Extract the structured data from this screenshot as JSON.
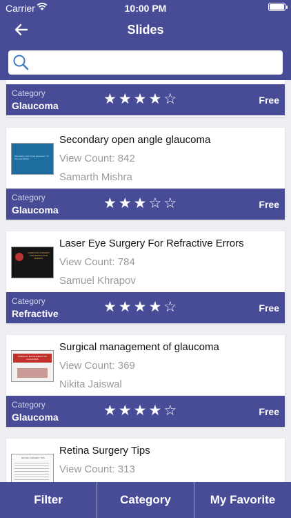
{
  "status": {
    "carrier": "Carrier",
    "time": "10:00 PM"
  },
  "header": {
    "title": "Slides"
  },
  "search": {
    "placeholder": "",
    "value": ""
  },
  "category_label": "Category",
  "top_card": {
    "category": "Glaucoma",
    "rating": 4,
    "price": "Free"
  },
  "slides": [
    {
      "title": "Secondary open angle glaucoma",
      "view_count": "View Count: 842",
      "author": "Samarth Mishra",
      "category": "Glaucoma",
      "rating": 3,
      "price": "Free"
    },
    {
      "title": "Laser Eye Surgery For Refractive Errors",
      "view_count": "View Count: 784",
      "author": "Samuel Khrapov",
      "category": "Refractive",
      "rating": 4,
      "price": "Free"
    },
    {
      "title": "Surgical management of glaucoma",
      "view_count": "View Count: 369",
      "author": "Nikita Jaiswal",
      "category": "Glaucoma",
      "rating": 4,
      "price": "Free"
    },
    {
      "title": "Retina Surgery Tips",
      "view_count": "View Count: 313"
    }
  ],
  "thumbnails": [
    {
      "text": "Secondary open angle glaucoma · Dr. Samarth Mishra"
    },
    {
      "text": "LASER EYE SURGERY FOR REFRACTIVE ERRORS"
    },
    {
      "text": "SURGICAL MANAGEMENT OF GLAUCOMA"
    },
    {
      "text": "RETINA SURGERY TIPS"
    }
  ],
  "tabs": {
    "filter": "Filter",
    "category": "Category",
    "favorite": "My Favorite"
  },
  "colors": {
    "primary": "#484b96",
    "background": "#eeeef2",
    "muted_text": "#9a9a9a"
  }
}
